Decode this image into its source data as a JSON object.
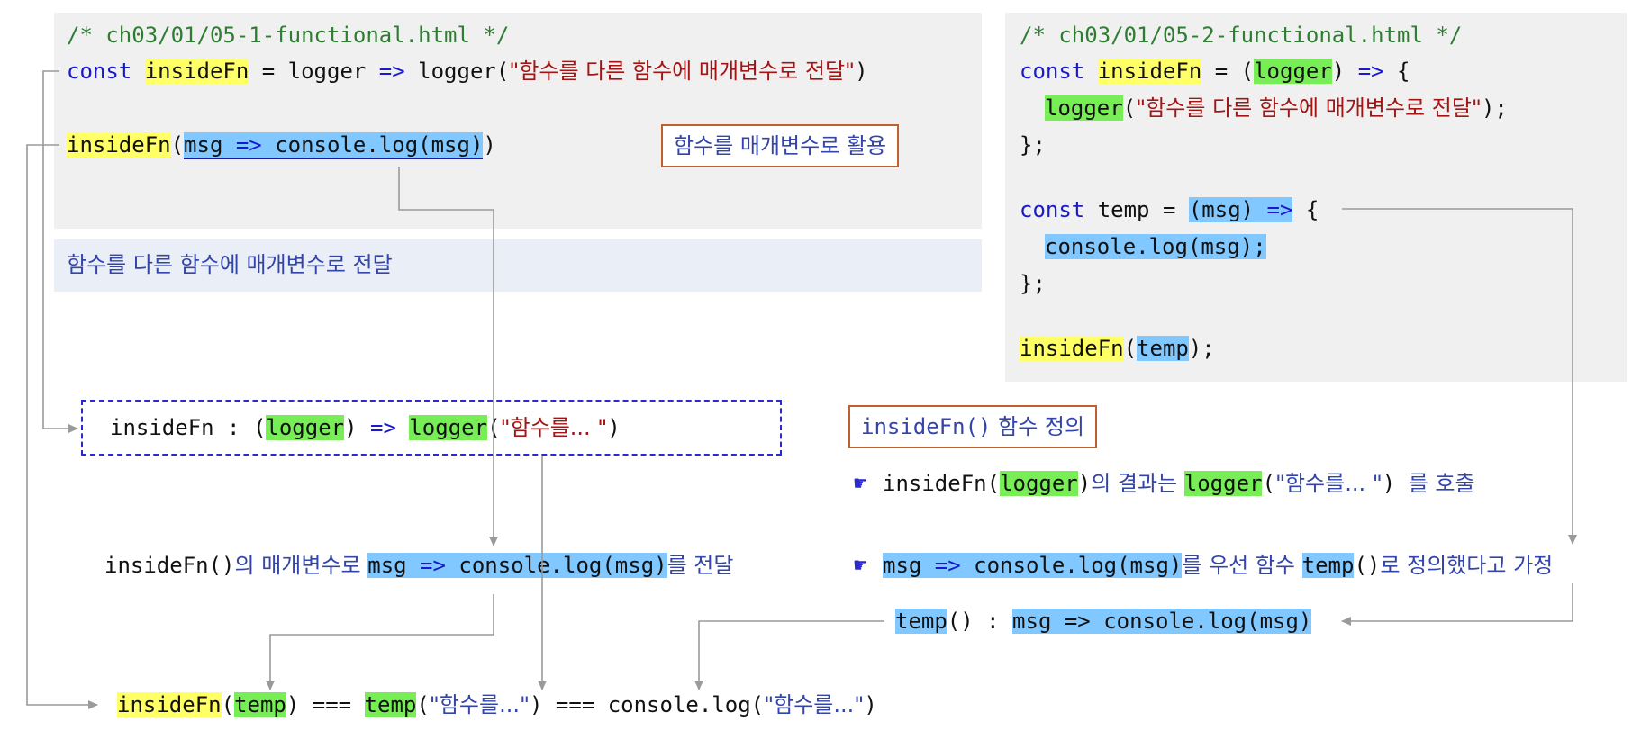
{
  "left_code": {
    "comment": "/* ch03/01/05-1-functional.html */",
    "line1": {
      "const": "const",
      "name": "insideFn",
      "eq": " = logger ",
      "arrow": "=>",
      "rest": " logger(",
      "str": "\"함수를 다른 함수에 매개변수로 전달\"",
      "close": ")"
    },
    "line2": {
      "name": "insideFn",
      "open": "(",
      "arg_a": "msg ",
      "arg_arrow": "=>",
      "arg_b": " console.log(msg)",
      "close": ")"
    },
    "tag": "함수를 매개변수로 활용"
  },
  "caption": "함수를 다른 함수에 매개변수로 전달",
  "right_code": {
    "comment": "/* ch03/01/05-2-functional.html */",
    "l1": {
      "const": "const",
      "name": "insideFn",
      "mid": " = (",
      "param": "logger",
      "mid2": ") ",
      "arrow": "=>",
      "end": " {"
    },
    "l2": {
      "fn": "logger",
      "open": "(",
      "str": "\"함수를 다른 함수에 매개변수로 전달\"",
      "close": ");"
    },
    "l3": "};",
    "l4": {
      "const": "const",
      "mid": " temp = ",
      "param": "(msg) ",
      "arrow": "=>",
      "end": " {"
    },
    "l5": "console.log(msg);",
    "l6": "};",
    "l7": {
      "name": "insideFn",
      "open": "(",
      "arg": "temp",
      "close": ");"
    }
  },
  "dashed_box": {
    "a": "insideFn : (",
    "param": "logger",
    "b": ") ",
    "arrow": "=>",
    "c": " ",
    "fn": "logger",
    "d": "(",
    "str": "\"함수를... \"",
    "e": ")"
  },
  "tag2": {
    "code": "insideFn()",
    "ko": " 함수 정의"
  },
  "note1": {
    "a": "insideFn(",
    "param": "logger",
    "b": ")",
    "ko1": "의 결과는 ",
    "fn": "logger",
    "c": "(",
    "str": "\"함수를... \"",
    "d": ") ",
    "ko2": "를 호출"
  },
  "note2": {
    "a": "msg ",
    "arrow": "=>",
    "b": " console.log(msg)",
    "ko1": "를 우선 함수 ",
    "fn": "temp",
    "c": "()",
    "ko2": "로 정의했다고 가정"
  },
  "note3": {
    "a": "insideFn()",
    "ko1": "의 매개변수로 ",
    "b": "msg ",
    "arrow": "=>",
    "c": " console.log(msg)",
    "ko2": "를 전달"
  },
  "temp_def": {
    "fn": "temp",
    "a": "() : ",
    "b": "msg => console.log(msg)"
  },
  "result": {
    "a": "insideFn",
    "b": "(",
    "c": "temp",
    "d": ") === ",
    "e": "temp",
    "f": "(",
    "str1": "\"함수를...\"",
    "g": ") === console.log(",
    "str2": "\"함수를...\"",
    "h": ")"
  },
  "icons": {
    "hand": "☛"
  },
  "colors": {
    "yellow": "#ffff66",
    "green": "#77ee55",
    "blue": "#80c8ff",
    "keyword": "#1a1acc",
    "comment": "#2e7d32",
    "string": "#a31515"
  }
}
